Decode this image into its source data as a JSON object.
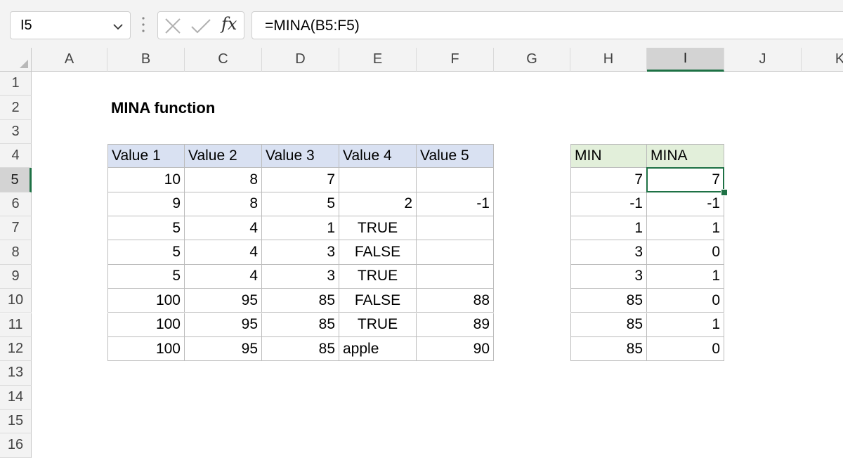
{
  "formula_bar": {
    "name_box": "I5",
    "fx_label": "fx",
    "formula": "=MINA(B5:F5)"
  },
  "columns": [
    "A",
    "B",
    "C",
    "D",
    "E",
    "F",
    "G",
    "H",
    "I",
    "J",
    "K"
  ],
  "rows": [
    "1",
    "2",
    "3",
    "4",
    "5",
    "6",
    "7",
    "8",
    "9",
    "10",
    "11",
    "12",
    "13",
    "14",
    "15",
    "16"
  ],
  "selected_cell": {
    "column": "I",
    "row": "5"
  },
  "sheet": {
    "title": "MINA function",
    "data_table": {
      "headers": [
        "Value 1",
        "Value 2",
        "Value 3",
        "Value 4",
        "Value 5"
      ],
      "rows": [
        [
          "10",
          "8",
          "7",
          "",
          ""
        ],
        [
          "9",
          "8",
          "5",
          "2",
          "-1"
        ],
        [
          "5",
          "4",
          "1",
          "TRUE",
          ""
        ],
        [
          "5",
          "4",
          "3",
          "FALSE",
          ""
        ],
        [
          "5",
          "4",
          "3",
          "TRUE",
          ""
        ],
        [
          "100",
          "95",
          "85",
          "FALSE",
          "88"
        ],
        [
          "100",
          "95",
          "85",
          "TRUE",
          "89"
        ],
        [
          "100",
          "95",
          "85",
          "apple",
          "90"
        ]
      ]
    },
    "result_table": {
      "headers": [
        "MIN",
        "MINA"
      ],
      "rows": [
        [
          "7",
          "7"
        ],
        [
          "-1",
          "-1"
        ],
        [
          "1",
          "1"
        ],
        [
          "3",
          "0"
        ],
        [
          "3",
          "1"
        ],
        [
          "85",
          "0"
        ],
        [
          "85",
          "1"
        ],
        [
          "85",
          "0"
        ]
      ]
    }
  },
  "colors": {
    "data_header": "#d9e1f2",
    "result_header": "#e2efda",
    "selection": "#1e7145"
  }
}
